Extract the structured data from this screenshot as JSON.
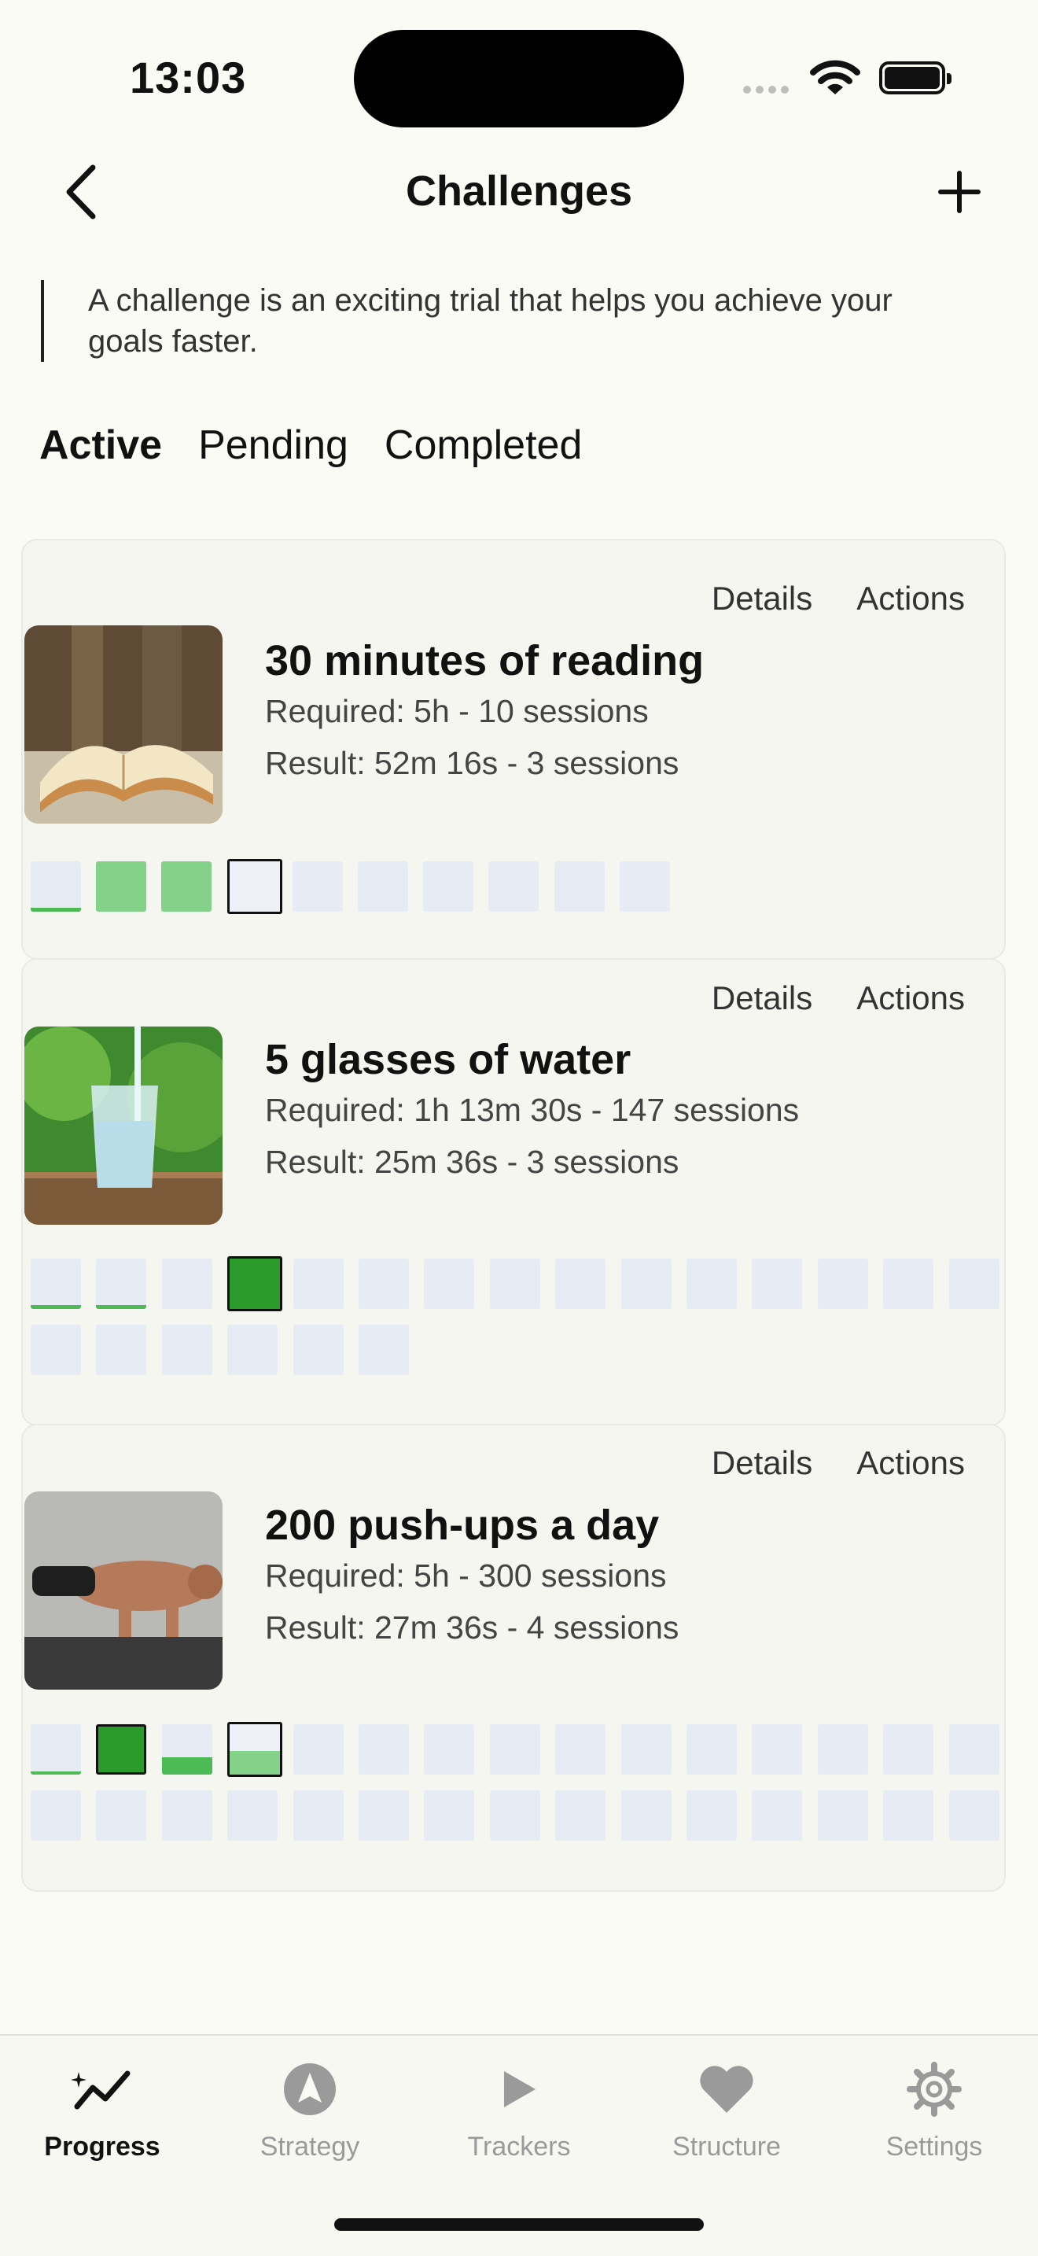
{
  "status": {
    "time": "13:03"
  },
  "header": {
    "title": "Challenges"
  },
  "intro": "A challenge is an exciting trial that helps you achieve your goals faster.",
  "tabs": [
    {
      "label": "Active"
    },
    {
      "label": "Pending"
    },
    {
      "label": "Completed"
    }
  ],
  "card_links": {
    "details": "Details",
    "actions": "Actions"
  },
  "challenges": [
    {
      "title": "30 minutes of reading",
      "required": "Required: 5h - 10 sessions",
      "result": "Result: 52m 16s - 3 sessions",
      "thumb_icon": "open-book-image"
    },
    {
      "title": "5 glasses of water",
      "required": "Required: 1h 13m 30s - 147 sessions",
      "result": "Result: 25m 36s - 3 sessions",
      "thumb_icon": "water-glass-image"
    },
    {
      "title": "200 push-ups a day",
      "required": "Required: 5h - 300 sessions",
      "result": "Result: 27m 36s - 4 sessions",
      "thumb_icon": "push-up-image"
    }
  ],
  "tab_bar": [
    {
      "label": "Progress",
      "icon": "progress-icon"
    },
    {
      "label": "Strategy",
      "icon": "strategy-icon"
    },
    {
      "label": "Trackers",
      "icon": "play-icon"
    },
    {
      "label": "Structure",
      "icon": "heart-icon"
    },
    {
      "label": "Settings",
      "icon": "gear-icon"
    }
  ],
  "colors": {
    "accent_green": "#2a9a2a",
    "light_green": "#84d289",
    "empty_cell": "#e7ebf4",
    "background": "#fbfbf6"
  }
}
